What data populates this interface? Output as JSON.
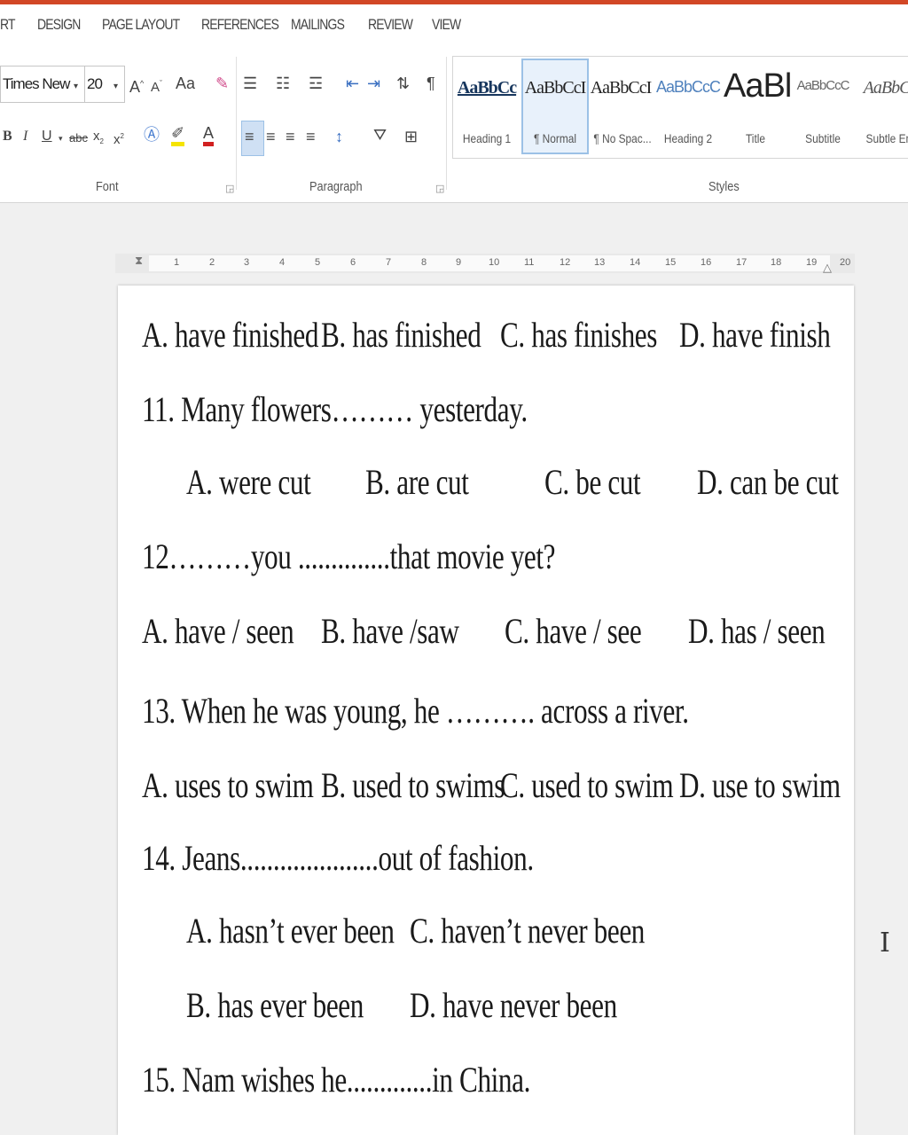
{
  "tabs": [
    "RT",
    "DESIGN",
    "PAGE LAYOUT",
    "REFERENCES",
    "MAILINGS",
    "REVIEW",
    "VIEW"
  ],
  "font": {
    "name": "Times New Ro",
    "size": "20",
    "change_case": "Aa"
  },
  "group_labels": {
    "font": "Font",
    "paragraph": "Paragraph",
    "styles": "Styles"
  },
  "styles": [
    {
      "sample": "AaBbCc",
      "name": "Heading 1"
    },
    {
      "sample": "AaBbCcI",
      "name": "¶ Normal"
    },
    {
      "sample": "AaBbCcI",
      "name": "¶ No Spac..."
    },
    {
      "sample": "AaBbCcC",
      "name": "Heading 2"
    },
    {
      "sample": "AaBl",
      "name": "Title"
    },
    {
      "sample": "AaBbCcC",
      "name": "Subtitle"
    },
    {
      "sample": "AaBbCc",
      "name": "Subtle Em"
    }
  ],
  "ruler_numbers": [
    "1",
    "2",
    "3",
    "4",
    "5",
    "6",
    "7",
    "8",
    "9",
    "10",
    "11",
    "12",
    "13",
    "14",
    "15",
    "16",
    "17",
    "18",
    "19",
    "20"
  ],
  "document": {
    "q10_options": [
      "A. have finished",
      "B. has finished",
      "C. has finishes",
      "D. have finish"
    ],
    "q11": "11. Many flowers……… yesterday.",
    "q11_options": [
      "A. were cut",
      "B. are cut",
      "C. be cut",
      "D. can be cut"
    ],
    "q12": "12………you ..............that movie yet?",
    "q12_options": [
      "A. have / seen",
      "B. have /saw",
      "C. have / see",
      "D. has / seen"
    ],
    "q13": "13. When he was young, he ………. across a river.",
    "q13_options": [
      "A. uses to swim",
      "B. used to swims",
      "C. used to swim",
      "D. use to swim"
    ],
    "q14": "14. Jeans.....................out of fashion.",
    "q14_options": [
      "A. hasn’t ever been",
      "C. haven’t never been",
      "B. has ever been",
      "D. have never been"
    ],
    "q15": "15. Nam wishes he.............in China."
  }
}
